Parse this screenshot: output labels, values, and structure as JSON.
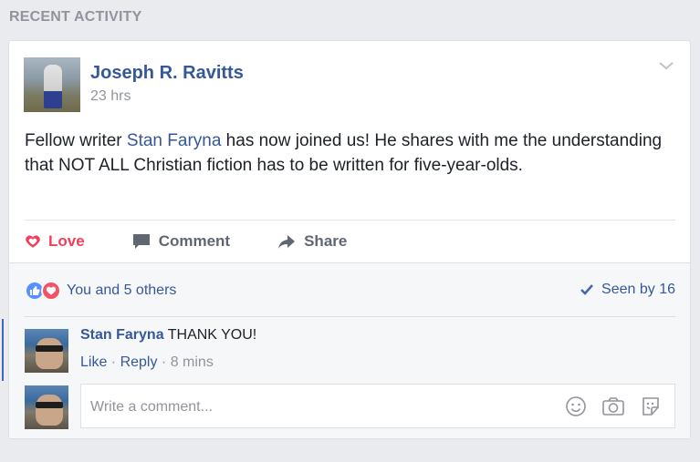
{
  "section": {
    "title": "RECENT ACTIVITY"
  },
  "post": {
    "author": "Joseph R. Ravitts",
    "time": "23 hrs",
    "text_before": "Fellow writer ",
    "mention": "Stan Faryna",
    "text_after": " has now joined us! He shares with me the understanding that NOT ALL Christian fiction has to be written for five-year-olds."
  },
  "actions": {
    "love": "Love",
    "comment": "Comment",
    "share": "Share"
  },
  "reactions": {
    "summary": "You and 5 others",
    "seen": "Seen by 16"
  },
  "comments": [
    {
      "name": "Stan Faryna",
      "text": " THANK YOU!",
      "like": "Like",
      "reply": "Reply",
      "sep": " · ",
      "time": "8 mins"
    }
  ],
  "composer": {
    "placeholder": "Write a comment..."
  },
  "colors": {
    "link": "#365899",
    "love": "#f33e58",
    "background": "#e9ebee"
  }
}
